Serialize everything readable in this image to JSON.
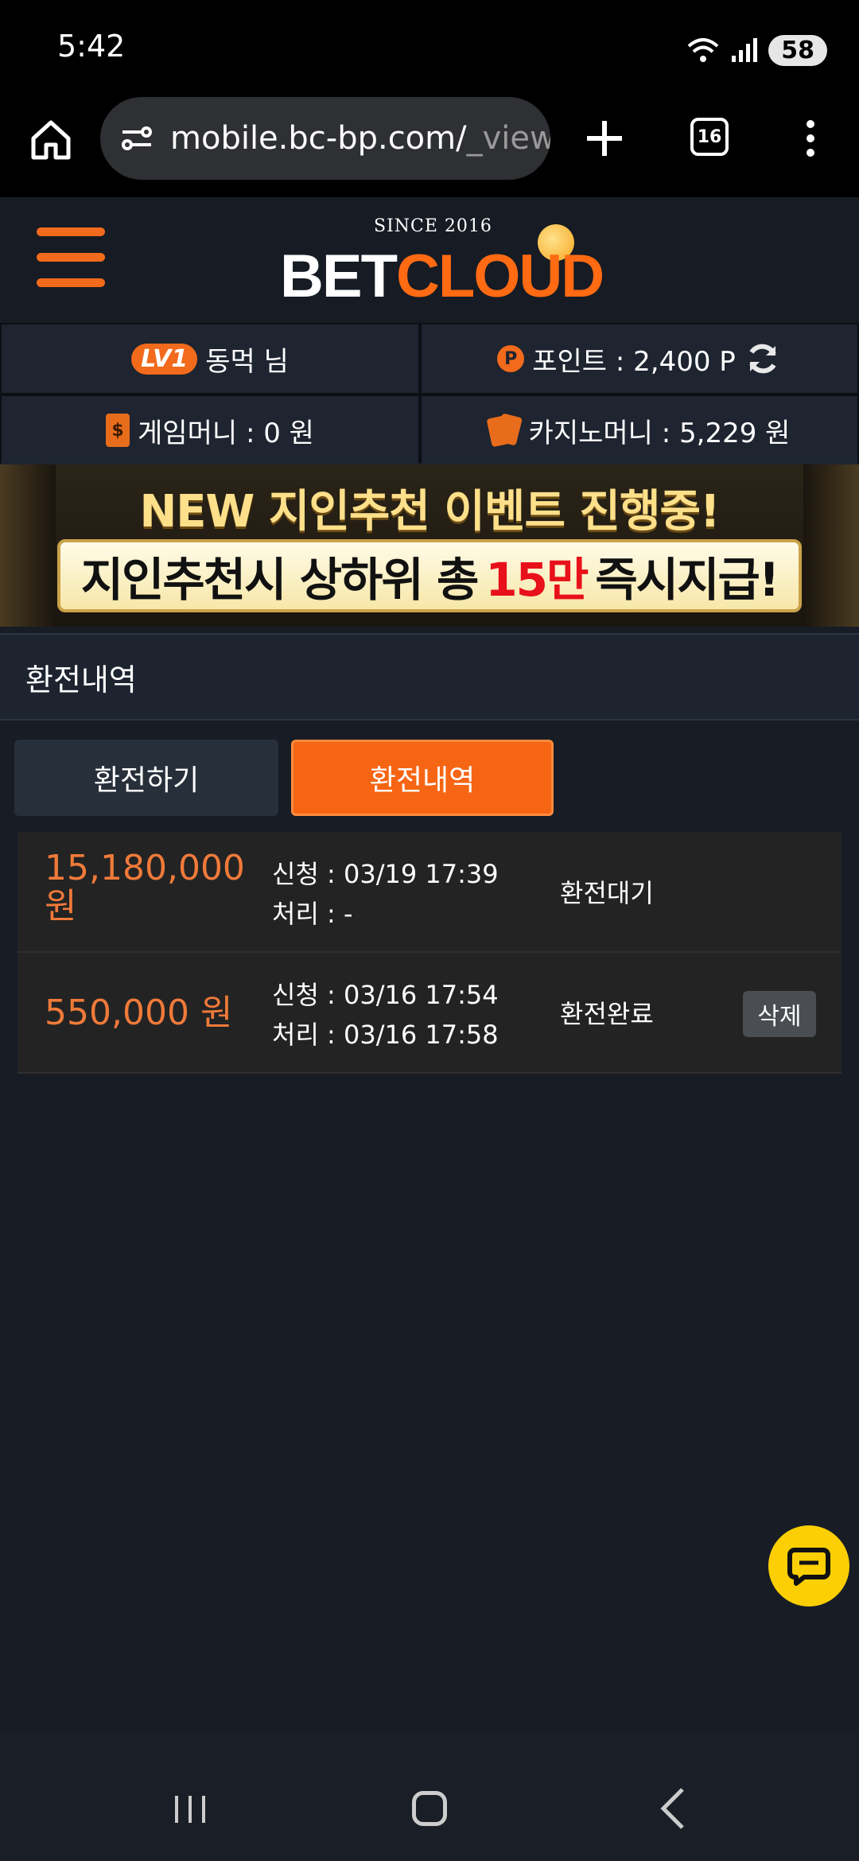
{
  "status_bar": {
    "time": "5:42",
    "battery": "58"
  },
  "browser": {
    "url_main": "mobile.bc-bp.com/",
    "url_fade": "_view",
    "tab_count": "16"
  },
  "site": {
    "logo_since": "SINCE 2016",
    "logo_bet": "BET",
    "logo_cloud": "CLOUD"
  },
  "user": {
    "level": "LV1",
    "name": "동먹 님",
    "points": "포인트 : 2,400 P",
    "game_money": "게임머니 : 0 원",
    "casino_money": "카지노머니 : 5,229 원"
  },
  "banner": {
    "top": "NEW 지인추천 이벤트 진행중!",
    "strip_pre": "지인추천시 상하위 총",
    "strip_hl": "15만",
    "strip_post": "즉시지급!"
  },
  "page": {
    "title": "환전내역"
  },
  "tabs": [
    {
      "label": "환전하기"
    },
    {
      "label": "환전내역"
    }
  ],
  "history": [
    {
      "amount": "15,180,000 원",
      "requested": "신청 : 03/19 17:39",
      "processed": "처리 : -",
      "status": "환전대기"
    },
    {
      "amount": "550,000 원",
      "requested": "신청 : 03/16 17:54",
      "processed": "처리 : 03/16 17:58",
      "status": "환전완료",
      "delete_label": "삭제"
    }
  ],
  "colors": {
    "accent": "#f66514",
    "chat": "#fccf04",
    "amount": "#f07a3a"
  }
}
